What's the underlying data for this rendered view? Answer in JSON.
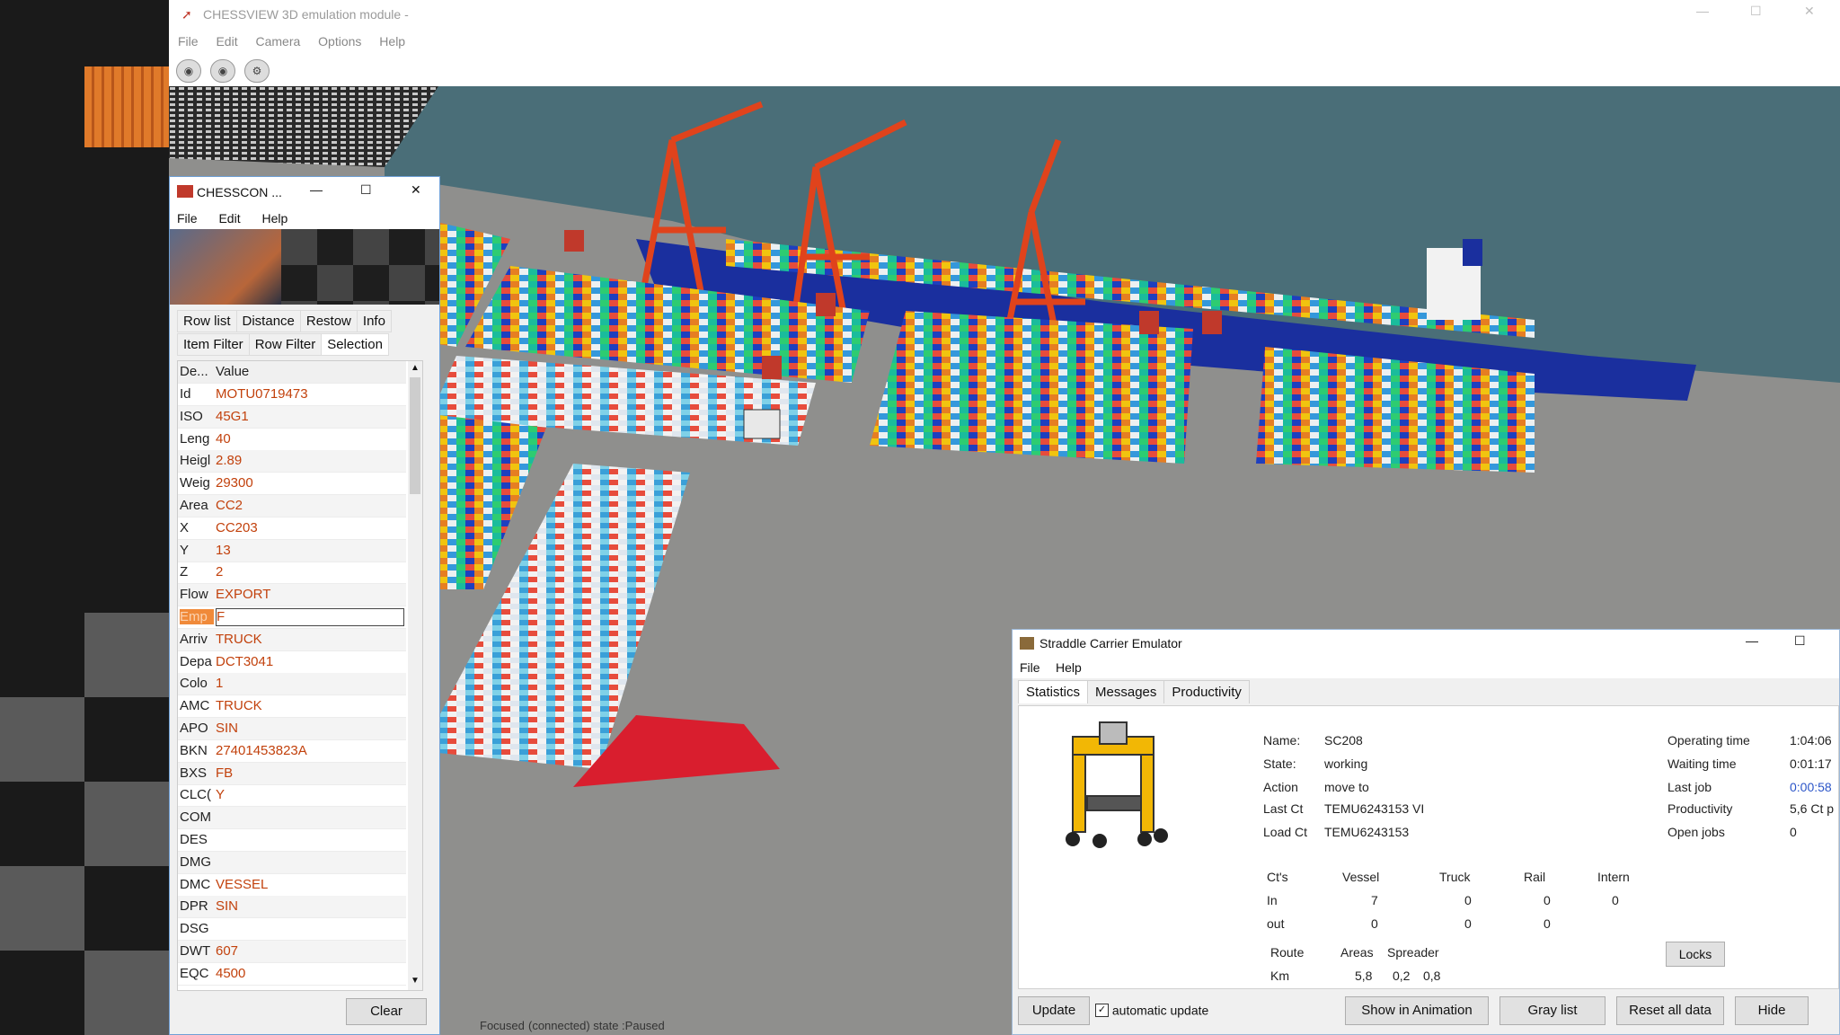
{
  "main_window": {
    "title": "CHESSVIEW 3D emulation module - ",
    "menu": [
      "File",
      "Edit",
      "Camera",
      "Options",
      "Help"
    ],
    "status_left": "Focused",
    "status_right": "(connected) state :Paused"
  },
  "chesscon": {
    "title": "CHESSCON ...",
    "menu": [
      "File",
      "Edit",
      "Help"
    ],
    "tabs_row1": [
      "Row list",
      "Distance",
      "Restow",
      "Info"
    ],
    "tabs_row2": [
      "Item Filter",
      "Row Filter",
      "Selection"
    ],
    "grid_header": {
      "key": "De...",
      "value": "Value"
    },
    "rows": [
      {
        "key": "Id",
        "value": "MOTU0719473"
      },
      {
        "key": "ISO",
        "value": "45G1"
      },
      {
        "key": "Leng",
        "value": "40"
      },
      {
        "key": "Heigl",
        "value": "2.89"
      },
      {
        "key": "Weig",
        "value": "29300"
      },
      {
        "key": "Area",
        "value": "CC2"
      },
      {
        "key": "X",
        "value": "CC203"
      },
      {
        "key": "Y",
        "value": "13"
      },
      {
        "key": "Z",
        "value": "2"
      },
      {
        "key": "Flow",
        "value": "EXPORT"
      },
      {
        "key": "Emp",
        "value": "F"
      },
      {
        "key": "Arriv",
        "value": "TRUCK"
      },
      {
        "key": "Depa",
        "value": "DCT3041"
      },
      {
        "key": "Colo",
        "value": "1"
      },
      {
        "key": "AMC",
        "value": "TRUCK"
      },
      {
        "key": "APO",
        "value": "SIN"
      },
      {
        "key": "BKN",
        "value": "27401453823A"
      },
      {
        "key": "BXS",
        "value": "FB"
      },
      {
        "key": "CLC(",
        "value": "Y"
      },
      {
        "key": "COM",
        "value": ""
      },
      {
        "key": "DES",
        "value": ""
      },
      {
        "key": "DMG",
        "value": ""
      },
      {
        "key": "DMC",
        "value": "VESSEL"
      },
      {
        "key": "DPR",
        "value": "SIN"
      },
      {
        "key": "DSG",
        "value": ""
      },
      {
        "key": "DWT",
        "value": "607"
      },
      {
        "key": "EQC",
        "value": "4500"
      }
    ],
    "selected_row": 10,
    "clear_label": "Clear"
  },
  "straddle": {
    "title": "Straddle Carrier Emulator",
    "menu": [
      "File",
      "Help"
    ],
    "tabs": [
      "Statistics",
      "Messages",
      "Productivity"
    ],
    "active_tab": "Statistics",
    "name_label": "Name:",
    "name": "SC208",
    "state_label": "State:",
    "state": "working",
    "action_label": "Action",
    "action": "move to",
    "lastct_label": "Last Ct",
    "lastct": "TEMU6243153 VI",
    "loadct_label": "Load Ct",
    "loadct": "TEMU6243153",
    "op_time_label": "Operating time",
    "op_time": "1:04:06",
    "wait_time_label": "Waiting time",
    "wait_time": "0:01:17",
    "last_job_label": "Last job",
    "last_job": "0:00:58",
    "productivity_label": "Productivity",
    "productivity": "5,6 Ct p",
    "open_jobs_label": "Open jobs",
    "open_jobs": "0",
    "cts_headers": [
      "Ct's",
      "Vessel",
      "Truck",
      "Rail",
      "Intern"
    ],
    "cts_in": [
      "In",
      "7",
      "0",
      "0",
      "0"
    ],
    "cts_out": [
      "out",
      "0",
      "0",
      "0"
    ],
    "route_headers": [
      "Route",
      "Areas",
      "Spreader"
    ],
    "route_km": [
      "Km",
      "5,8",
      "0,2",
      "0,8"
    ],
    "locks_label": "Locks",
    "update_label": "Update",
    "auto_update_label": "automatic update",
    "buttons": [
      "Show in Animation",
      "Gray list",
      "Reset all data",
      "Hide"
    ]
  },
  "colors": {
    "crane": "#e0431c",
    "ship": "#1a2f9e",
    "water": "#4a6e78",
    "quay": "#9a9a98",
    "accent_orange": "#c2410c"
  }
}
